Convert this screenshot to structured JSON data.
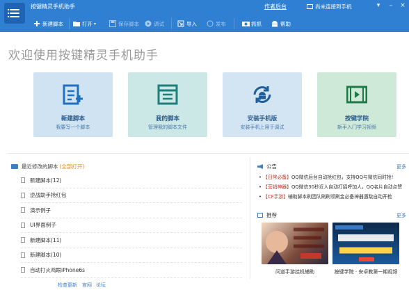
{
  "window": {
    "title": "按键精灵手机助手",
    "author_link": "作者后台",
    "device_status": "尚未连接到手机",
    "controls": [
      "▾",
      "–",
      "×"
    ]
  },
  "toolbar": {
    "new_script": "新建脚本",
    "open": "打开",
    "save_script": "保存脚本",
    "debug": "调试",
    "import": "导入",
    "publish": "发布",
    "capture": "抓抓",
    "help": "帮助"
  },
  "welcome": "欢迎使用按键精灵手机助手",
  "tiles": [
    {
      "title": "新建脚本",
      "subtitle": "我要写一个脚本",
      "icon": "new-script-icon",
      "bg": "#cfe3f3"
    },
    {
      "title": "我的脚本",
      "subtitle": "管理我的脚本文件",
      "icon": "my-scripts-icon",
      "bg": "#cbe7e6"
    },
    {
      "title": "安装手机版",
      "subtitle": "安装手机上用于调试",
      "icon": "install-mobile-icon",
      "bg": "#d3e4f3"
    },
    {
      "title": "按键学院",
      "subtitle": "新手入门学习视频",
      "icon": "video-academy-icon",
      "bg": "#cfe9d8"
    }
  ],
  "recent": {
    "heading": "最近修改的脚本",
    "open_all": "(全部打开)",
    "items": [
      "新建脚本(12)",
      "逆战助手抢红包",
      "演示例子",
      "UI界面例子",
      "新建脚本(11)",
      "新建脚本(10)",
      "自动打火鸡眼iPhone6s"
    ]
  },
  "notices": {
    "heading": "公告",
    "more": "更多",
    "items": [
      {
        "tag": "【日常必备】",
        "text": "QQ微信后台自动抢红包，支持QQ与微信同时抢!"
      },
      {
        "tag": "【营销神器】",
        "text": "QQ微信30秒近人自动打招呼加人，QQ名片自动点赞"
      },
      {
        "tag": "【CF手游】",
        "text": "辅助脚本刷团队刷刷领刷金必备神器遇敌自动开枪"
      }
    ]
  },
  "recommend": {
    "heading": "推荐",
    "more": "更多",
    "items": [
      {
        "caption": "问道手游挂机辅助"
      },
      {
        "caption": "按键学院 · 安卓教第一期视频"
      }
    ]
  },
  "bottom_links": [
    "检查更新",
    "官网",
    "论坛"
  ],
  "colors": {
    "primary": "#2f7fd3",
    "accent": "#e8891b"
  }
}
